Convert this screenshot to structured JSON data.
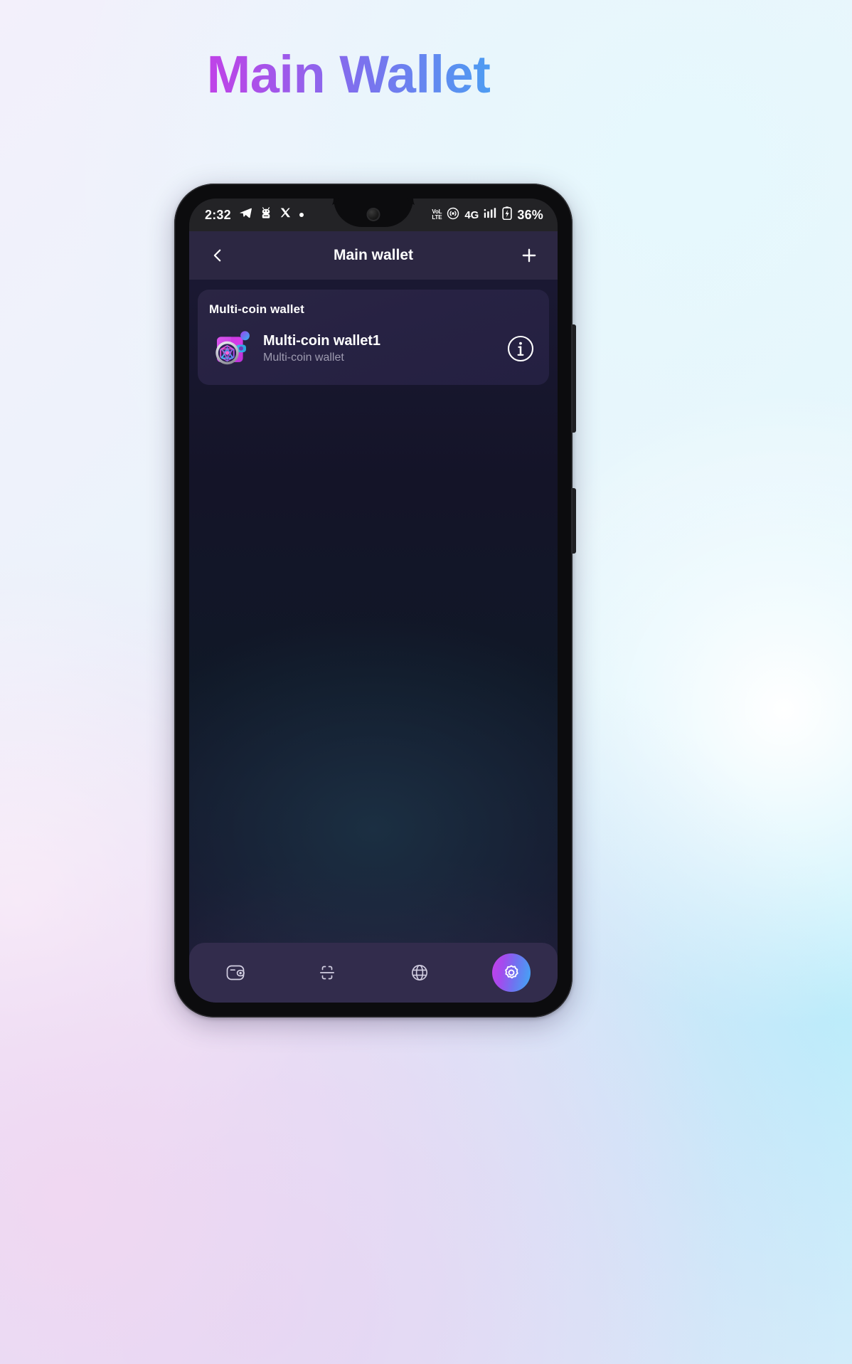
{
  "hero": {
    "title": "Main Wallet",
    "gradient_from": "#ff1ae0",
    "gradient_to": "#33c0f5"
  },
  "phone": {
    "status_bar": {
      "time": "2:32",
      "left_icons": [
        "telegram-icon",
        "android-robot-icon",
        "x-twitter-icon",
        "dot-icon"
      ],
      "volte_top": "VoL",
      "volte_bottom": "LTE",
      "network_type": "4G",
      "right_icons": [
        "volte-icon",
        "hotspot-icon",
        "network-type-label",
        "signal-bars-icon",
        "battery-charging-icon"
      ],
      "battery_percent": "36%"
    },
    "app_bar": {
      "back_label": "back-arrow",
      "title": "Main wallet",
      "add_label": "add"
    },
    "wallet_card": {
      "section_title": "Multi-coin wallet",
      "row": {
        "name": "Multi-coin wallet1",
        "subtitle": "Multi-coin wallet",
        "avatar_icon": "multi-coin-wallet-avatar",
        "info_icon": "info-circle-icon"
      }
    },
    "bottom_nav": {
      "items": [
        {
          "id": "wallet",
          "icon": "wallet-icon",
          "active": false
        },
        {
          "id": "scan",
          "icon": "scan-icon",
          "active": false
        },
        {
          "id": "browser",
          "icon": "globe-icon",
          "active": false
        },
        {
          "id": "settings",
          "icon": "gear-icon",
          "active": true
        }
      ],
      "active_gradient_from": "#c540e8",
      "active_gradient_to": "#3fa9f5"
    }
  },
  "colors": {
    "app_bar_bg": "#2c2742",
    "card_bg": "#2a2543",
    "nav_bg": "#322c4c",
    "text_primary": "#ffffff",
    "text_secondary": "#9e9bb0"
  }
}
